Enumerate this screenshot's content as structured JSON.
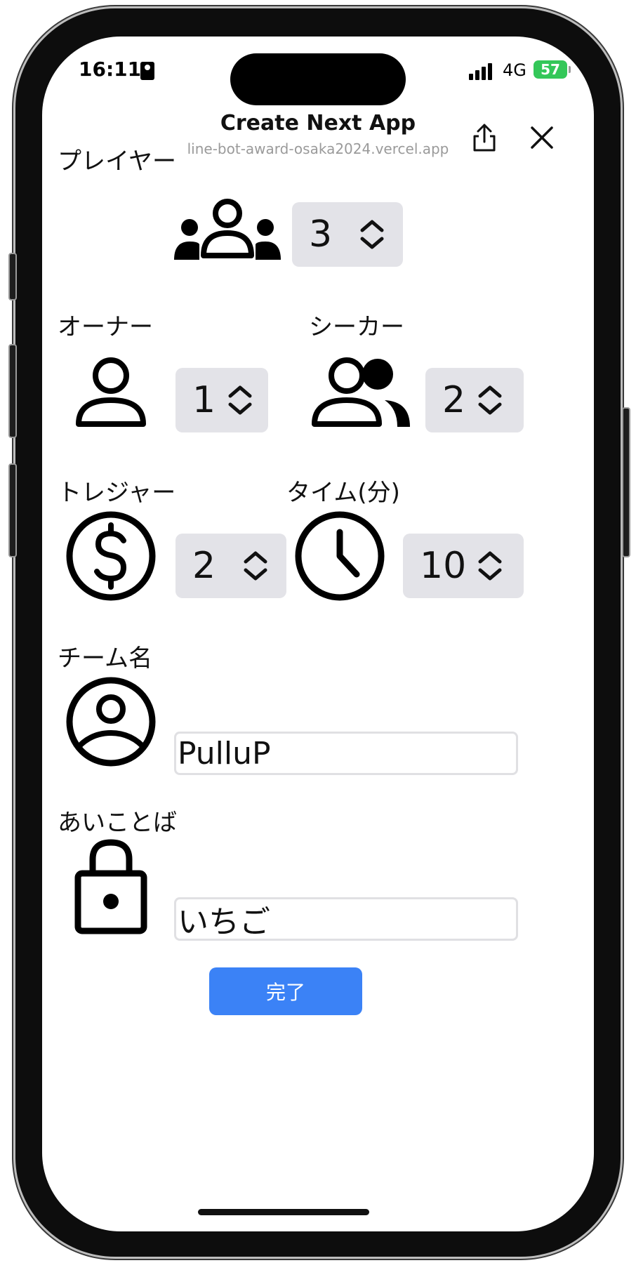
{
  "status_bar": {
    "time": "16:11",
    "network": "4G",
    "battery": "57"
  },
  "nav": {
    "title": "Create Next App",
    "url": "line-bot-award-osaka2024.vercel.app",
    "share_icon": "share-icon",
    "close_icon": "close-icon"
  },
  "form": {
    "players": {
      "label": "プレイヤー",
      "value": "3",
      "icon": "group-icon"
    },
    "owner": {
      "label": "オーナー",
      "value": "1",
      "icon": "user-icon"
    },
    "seeker": {
      "label": "シーカー",
      "value": "2",
      "icon": "users-icon"
    },
    "treasure": {
      "label": "トレジャー",
      "value": "2",
      "icon": "dollar-circle-icon"
    },
    "time": {
      "label": "タイム(分)",
      "value": "10",
      "icon": "clock-icon"
    },
    "team_name": {
      "label": "チーム名",
      "value": "PulluP",
      "icon": "user-circle-icon"
    },
    "passphrase": {
      "label": "あいことば",
      "value": "いちご",
      "icon": "lock-icon"
    }
  },
  "done_button": {
    "label": "完了"
  },
  "colors": {
    "accent": "#3b82f6",
    "stepper_bg": "#e3e3e8",
    "battery": "#34c759"
  }
}
